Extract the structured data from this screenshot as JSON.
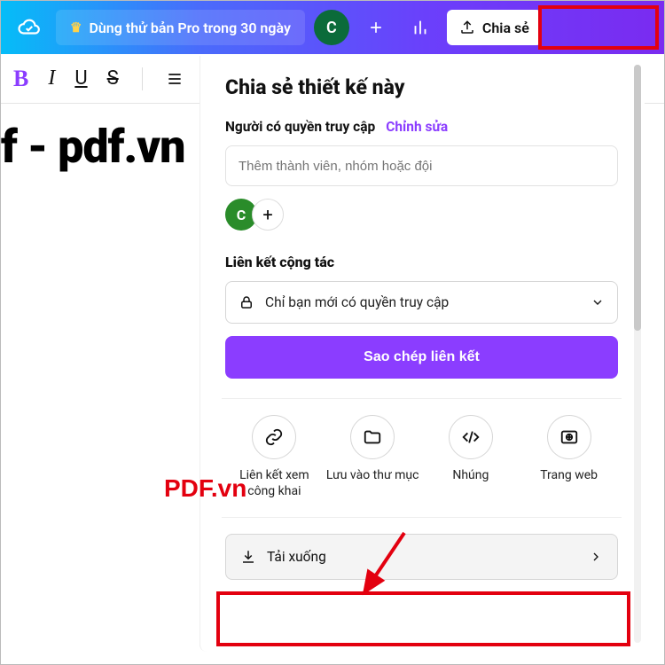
{
  "topbar": {
    "pro_label": "Dùng thử bản Pro trong 30 ngày",
    "avatar_letter": "C",
    "share_label": "Chia sẻ"
  },
  "toolbar": {
    "bold": "B",
    "italic": "I",
    "underline": "U",
    "strike": "S"
  },
  "canvas": {
    "visible_text": "f - pdf.vn"
  },
  "share_panel": {
    "title": "Chia sẻ thiết kế này",
    "access_label": "Người có quyền truy cập",
    "edit_label": "Chỉnh sửa",
    "members_placeholder": "Thêm thành viên, nhóm hoặc đội",
    "avatar_letter": "C",
    "collab_title": "Liên kết cộng tác",
    "access_select_label": "Chỉ bạn mới có quyền truy cập",
    "copy_link_label": "Sao chép liên kết",
    "options": [
      {
        "label": "Liên kết xem công khai",
        "icon": "link"
      },
      {
        "label": "Lưu vào thư mục",
        "icon": "folder"
      },
      {
        "label": "Nhúng",
        "icon": "embed"
      },
      {
        "label": "Trang web",
        "icon": "web"
      }
    ],
    "download_label": "Tải xuống"
  },
  "watermark": "PDF.vn"
}
